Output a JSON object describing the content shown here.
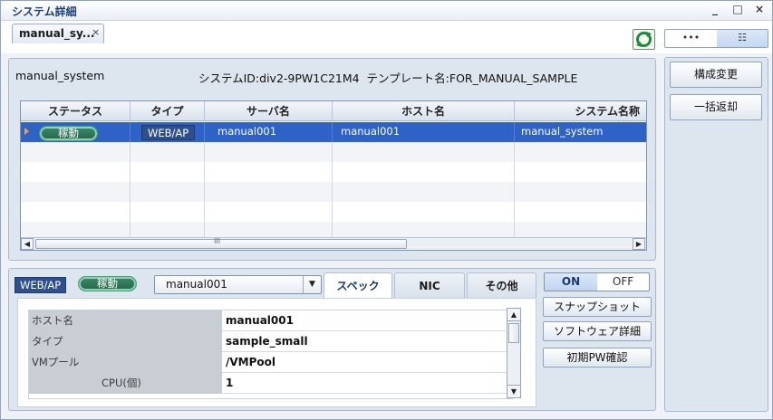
{
  "window": {
    "title": "システム詳細",
    "controls": [
      "_",
      "□",
      "×"
    ]
  },
  "doc_tab": {
    "label": "manual_sy...",
    "close": "×"
  },
  "view_switch": {
    "left": "•••",
    "right": "☷"
  },
  "summary": {
    "system_name": "manual_system",
    "system_id_text": "システムID:div2-9PW1C21M4",
    "template_text": "テンプレート名:FOR_MANUAL_SAMPLE"
  },
  "grid": {
    "columns": [
      "ステータス",
      "タイプ",
      "サーバ名",
      "ホスト名",
      "システム名称"
    ],
    "rows": [
      {
        "status": "稼動",
        "type": "WEB/AP",
        "server": "manual001",
        "host": "manual001",
        "system": "manual_system"
      }
    ],
    "scroll_grip": "III"
  },
  "detail": {
    "type_badge": "WEB/AP",
    "status_badge": "稼動",
    "server_select": "manual001",
    "tabs": [
      "スペック",
      "NIC",
      "その他"
    ],
    "spec_rows": [
      {
        "key": "ホスト名",
        "value": "manual001"
      },
      {
        "key": "タイプ",
        "value": "sample_small"
      },
      {
        "key": "VMプール",
        "value": "/VMPool"
      },
      {
        "key": "CPU(個)",
        "value": "1"
      }
    ]
  },
  "power_toggle": {
    "on": "ON",
    "off": "OFF"
  },
  "detail_buttons": [
    "スナップショット",
    "ソフトウェア詳細",
    "初期PW確認"
  ],
  "side_buttons": [
    "構成変更",
    "一括返却"
  ]
}
